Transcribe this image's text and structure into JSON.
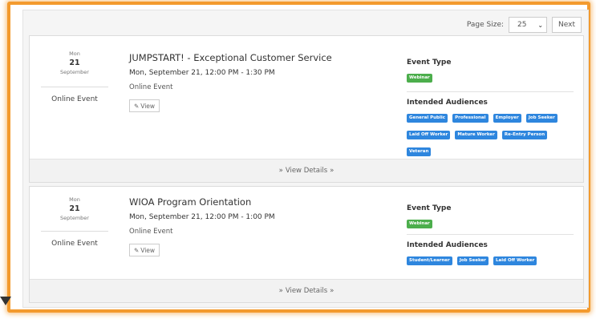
{
  "toolbar": {
    "page_size_label": "Page Size:",
    "page_size_value": "25",
    "next_label": "Next"
  },
  "events": [
    {
      "dow": "Mon",
      "day": "21",
      "month": "September",
      "location": "Online Event",
      "title": "JUMPSTART! - Exceptional Customer Service",
      "when": "Mon, September 21, 12:00 PM - 1:30 PM",
      "online_text": "Online Event",
      "view_label": "View",
      "event_type_heading": "Event Type",
      "event_type": "Webinar",
      "audiences_heading": "Intended Audiences",
      "audiences": [
        "General Public",
        "Professional",
        "Employer",
        "Job Seeker",
        "Laid Off Worker",
        "Mature Worker",
        "Re-Entry Person",
        "Veteran"
      ],
      "details_label": "View Details"
    },
    {
      "dow": "Mon",
      "day": "21",
      "month": "September",
      "location": "Online Event",
      "title": "WIOA Program Orientation",
      "when": "Mon, September 21, 12:00 PM - 1:00 PM",
      "online_text": "Online Event",
      "view_label": "View",
      "event_type_heading": "Event Type",
      "event_type": "Webinar",
      "audiences_heading": "Intended Audiences",
      "audiences": [
        "Student/Learner",
        "Job Seeker",
        "Laid Off Worker"
      ],
      "details_label": "View Details"
    }
  ],
  "colors": {
    "highlight": "#f39a2e",
    "type_badge": "#4cae4c",
    "audience_badge": "#2e86de"
  },
  "icons": {
    "view": "edit-icon",
    "expand": "double-chevron-down-icon",
    "dropdown": "chevron-down-icon"
  }
}
